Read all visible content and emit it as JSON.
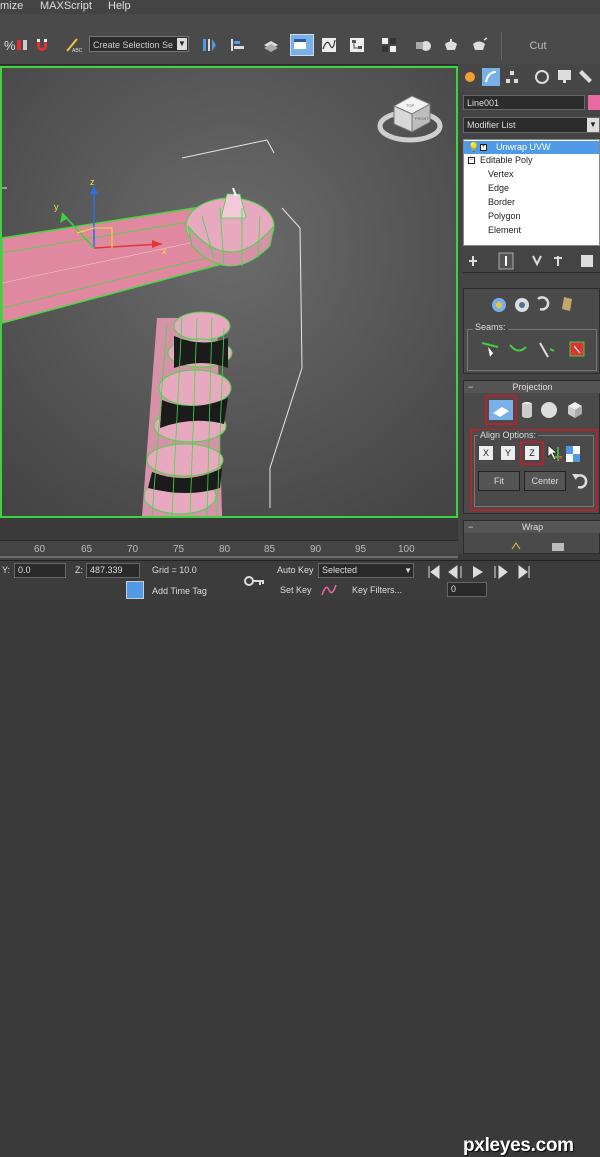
{
  "menu": {
    "items": [
      "mize",
      "MAXScript",
      "Help"
    ]
  },
  "toolbar": {
    "selection_set": "Create Selection Se",
    "cut_label": "Cut"
  },
  "viewport": {
    "cube_labels": {
      "top": "TOP",
      "front": "FRONT"
    },
    "gizmo": {
      "x": "x",
      "y": "y",
      "z": "z"
    }
  },
  "panel": {
    "object_name": "Line001",
    "modifier_list": "Modifier List",
    "color": "#e96aa2",
    "stack": [
      {
        "label": "Unwrap UVW",
        "selected": true
      },
      {
        "label": "Editable Poly",
        "selected": false
      },
      {
        "label": "Vertex",
        "selected": false
      },
      {
        "label": "Edge",
        "selected": false
      },
      {
        "label": "Border",
        "selected": false
      },
      {
        "label": "Polygon",
        "selected": false
      },
      {
        "label": "Element",
        "selected": false
      }
    ],
    "seams_label": "Seams:",
    "projection_title": "Projection",
    "align_options_label": "Align Options:",
    "align_x": "X",
    "align_y": "Y",
    "align_z": "Z",
    "fit_label": "Fit",
    "center_label": "Center",
    "wrap_title": "Wrap"
  },
  "timeline": {
    "ticks": [
      "60",
      "65",
      "70",
      "75",
      "80",
      "85",
      "90",
      "95",
      "100"
    ]
  },
  "status": {
    "y_label": "Y:",
    "y_value": "0.0",
    "z_label": "Z:",
    "z_value": "487.339",
    "grid": "Grid = 10.0",
    "add_time_tag": "Add Time Tag",
    "auto_key": "Auto Key",
    "selected": "Selected",
    "set_key": "Set Key",
    "key_filters": "Key Filters...",
    "frame_value": "0"
  },
  "watermark": "pxleyes.com"
}
